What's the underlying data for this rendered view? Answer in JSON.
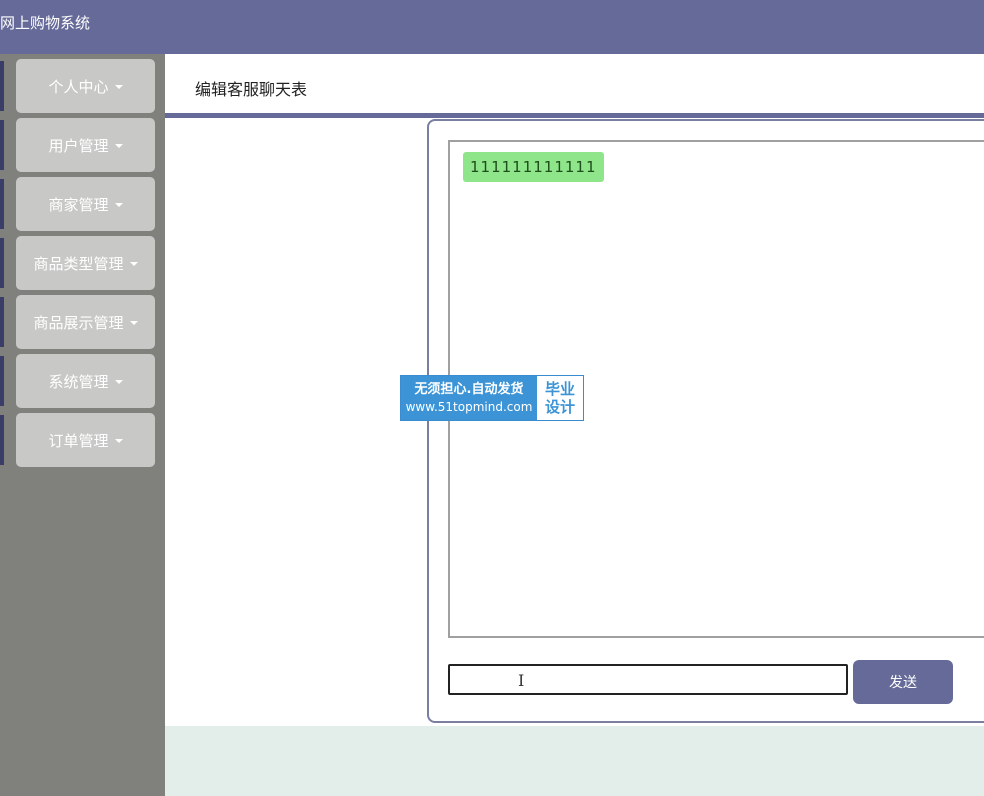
{
  "header": {
    "app_title": "网上购物系统"
  },
  "sidebar": {
    "items": [
      {
        "label": "个人中心"
      },
      {
        "label": "用户管理"
      },
      {
        "label": "商家管理"
      },
      {
        "label": "商品类型管理"
      },
      {
        "label": "商品展示管理"
      },
      {
        "label": "系统管理"
      },
      {
        "label": "订单管理"
      }
    ]
  },
  "breadcrumb": {
    "title": "编辑客服聊天表"
  },
  "chat": {
    "messages": [
      {
        "text": "111111111111"
      }
    ],
    "input_value": "",
    "send_label": "发送"
  },
  "watermark": {
    "line1": "无须担心.自动发货",
    "line2": "www.51topmind.com",
    "badge_line1": "毕业",
    "badge_line2": "设计"
  },
  "colors": {
    "header_bg": "#656a98",
    "sidebar_bg": "#80817d",
    "menu_card_bg": "#c8c9c6",
    "accent": "#3a3d67",
    "bubble_bg": "#8fe68a",
    "footer_bg": "#e3ede9"
  }
}
